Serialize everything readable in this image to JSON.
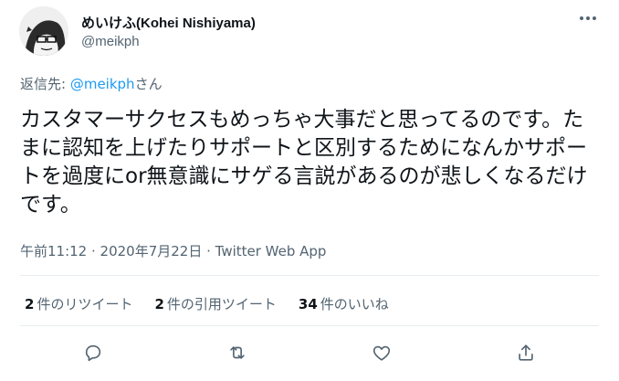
{
  "author": {
    "name": "めいけふ(Kohei Nishiyama)",
    "handle": "@meikph"
  },
  "reply": {
    "prefix": "返信先: ",
    "target": "@meikph",
    "suffix": "さん"
  },
  "tweet_text": "カスタマーサクセスもめっちゃ大事だと思ってるのです。たまに認知を上げたりサポートと区別するためになんかサポートを過度にor無意識にサゲる言説があるのが悲しくなるだけです。",
  "meta": "午前11:12 · 2020年7月22日 · Twitter Web App",
  "stats": {
    "retweets": {
      "count": "2",
      "label": "件のリツイート"
    },
    "quotes": {
      "count": "2",
      "label": "件の引用ツイート"
    },
    "likes": {
      "count": "34",
      "label": "件のいいね"
    }
  },
  "icons": {
    "more": "more-icon",
    "reply": "reply-icon",
    "retweet": "retweet-icon",
    "like": "like-icon",
    "share": "share-icon"
  },
  "colors": {
    "accent": "#1d9bf0",
    "muted": "#536471",
    "text": "#0f1419",
    "divider": "#e6ecf0"
  }
}
